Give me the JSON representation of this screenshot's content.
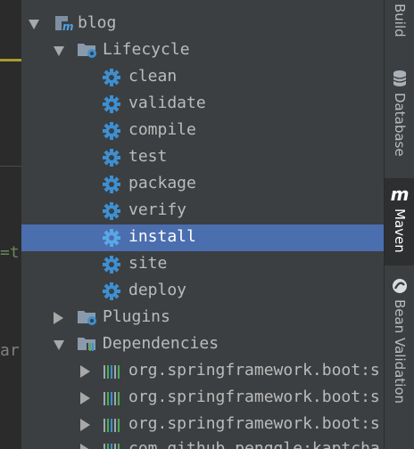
{
  "tree": {
    "root": {
      "label": "blog",
      "icon": "maven-module-icon"
    },
    "lifecycle": {
      "label": "Lifecycle",
      "icon": "folder-gear-icon"
    },
    "goals": [
      {
        "label": "clean"
      },
      {
        "label": "validate"
      },
      {
        "label": "compile"
      },
      {
        "label": "test"
      },
      {
        "label": "package"
      },
      {
        "label": "verify"
      },
      {
        "label": "install",
        "selected": true
      },
      {
        "label": "site"
      },
      {
        "label": "deploy"
      }
    ],
    "plugins": {
      "label": "Plugins",
      "icon": "folder-gear-icon"
    },
    "dependencies": {
      "label": "Dependencies",
      "icon": "folder-library-icon"
    },
    "deps": [
      {
        "label": "org.springframework.boot:s"
      },
      {
        "label": "org.springframework.boot:s"
      },
      {
        "label": "org.springframework.boot:s"
      },
      {
        "label": "com.github.penggle:kaptcha"
      }
    ]
  },
  "sidebar": {
    "tabs": [
      {
        "label": "Build",
        "icon": "build-icon"
      },
      {
        "label": "Database",
        "icon": "database-icon"
      },
      {
        "label": "Maven",
        "icon": "maven-icon",
        "active": true
      },
      {
        "label": "Bean Validation",
        "icon": "bean-icon"
      }
    ]
  },
  "editor": {
    "frag1": "=t",
    "frag2": "ar"
  },
  "colors": {
    "selection": "#4b6eaf",
    "gear": "#3d8fd1",
    "background": "#3c3f41"
  }
}
